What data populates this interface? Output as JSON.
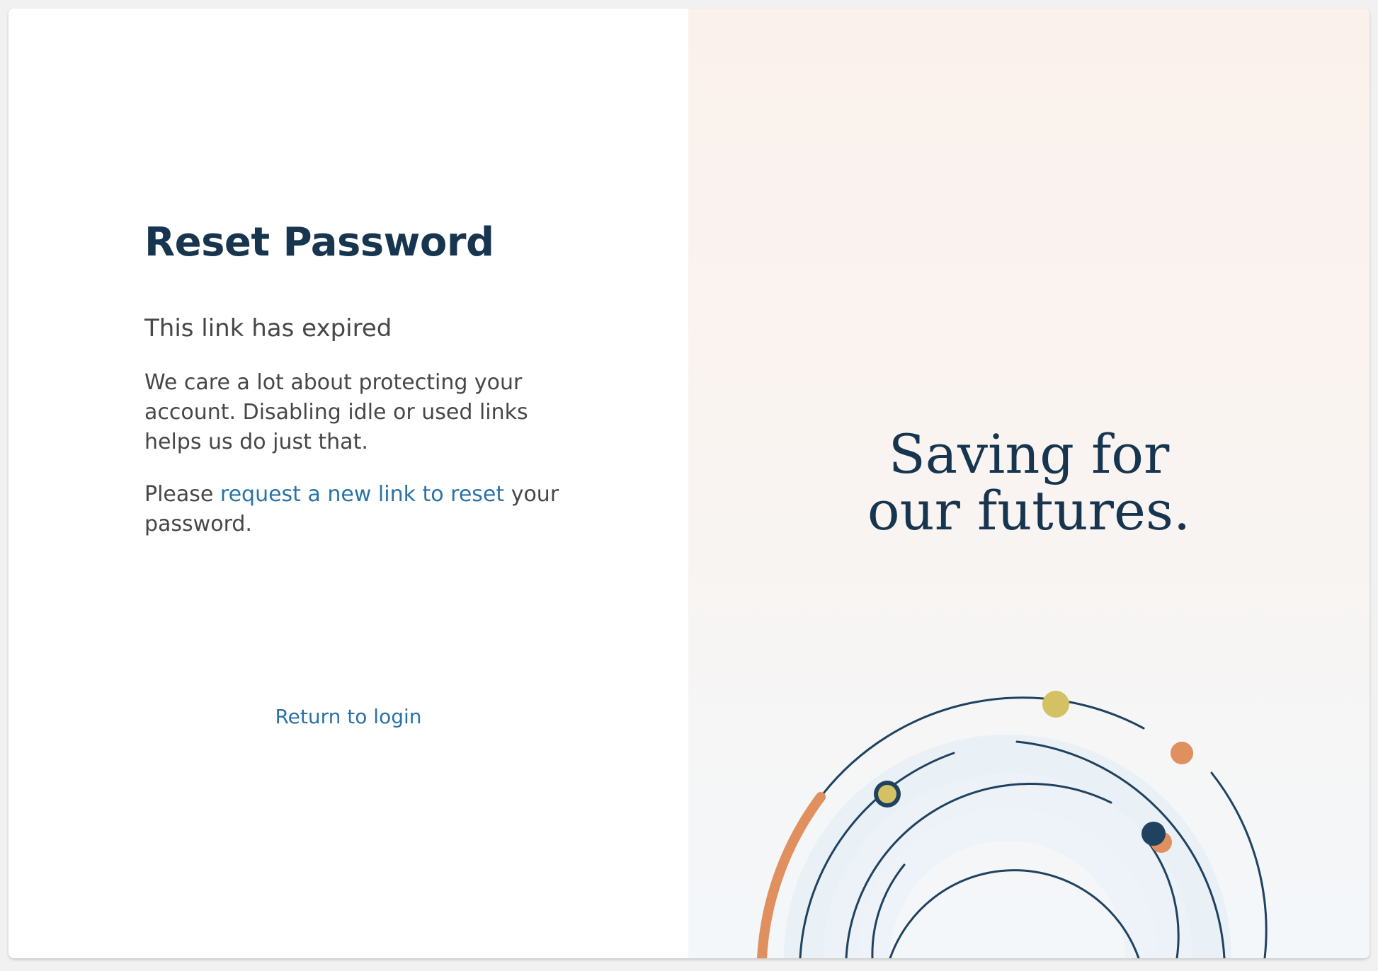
{
  "reset": {
    "title": "Reset Password",
    "subtitle": "This link has expired",
    "paragraph": "We care a lot about protecting your account. Disabling idle or used links helps us do just that.",
    "request_prefix": "Please ",
    "request_link": "request a new link to reset",
    "request_suffix": " your password.",
    "return_link": "Return to login"
  },
  "promo": {
    "tagline_line1": "Saving for",
    "tagline_line2": "our futures."
  },
  "colors": {
    "navy": "#17354f",
    "link": "#2a72a7",
    "orange": "#e08f5f",
    "yellow": "#d3c164",
    "band": "#e9f0f6",
    "panel_bg": "#fbf1ec"
  },
  "icons": {
    "decoration": "orbit-arcs-illustration"
  }
}
